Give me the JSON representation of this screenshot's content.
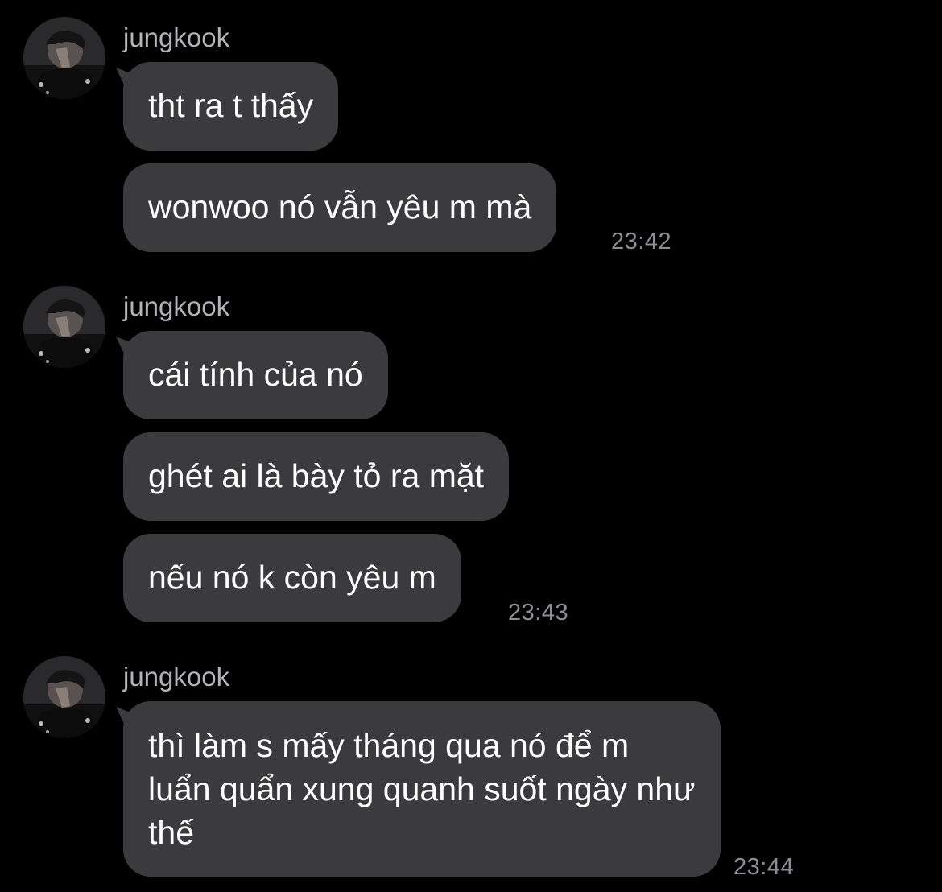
{
  "colors": {
    "background": "#000000",
    "bubble": "#3b3b3d",
    "message_text": "#ffffff",
    "sender_text": "#b4b4b8",
    "timestamp_text": "#8e8e93"
  },
  "groups": [
    {
      "sender": "jungkook",
      "avatar_icon": "profile-photo",
      "messages": [
        "tht ra t thấy",
        "wonwoo nó vẫn yêu m mà"
      ],
      "time": "23:42"
    },
    {
      "sender": "jungkook",
      "avatar_icon": "profile-photo",
      "messages": [
        "cái tính của nó",
        "ghét ai là bày tỏ ra mặt",
        "nếu nó k còn yêu m"
      ],
      "time": "23:43"
    },
    {
      "sender": "jungkook",
      "avatar_icon": "profile-photo",
      "messages": [
        "thì làm s mấy tháng qua nó để m luẩn quẩn xung quanh suốt ngày như thế"
      ],
      "time": "23:44"
    }
  ]
}
